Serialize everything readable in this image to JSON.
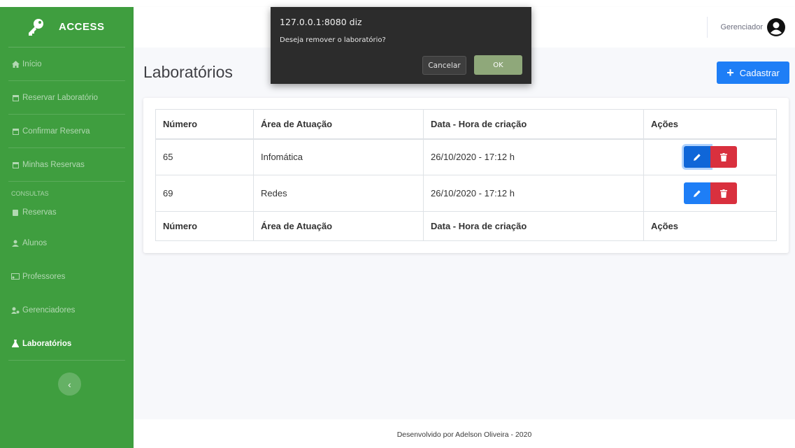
{
  "brand": {
    "name": "ACCESS"
  },
  "sidebar": {
    "items": [
      {
        "label": "Início",
        "icon": "home-icon"
      },
      {
        "label": "Reservar Laboratório",
        "icon": "calendar-icon"
      },
      {
        "label": "Confirmar Reserva",
        "icon": "calendar-check-icon"
      },
      {
        "label": "Minhas Reservas",
        "icon": "calendar-list-icon"
      }
    ],
    "section_heading": "CONSULTAS",
    "consultas": [
      {
        "label": "Reservas",
        "icon": "clipboard-icon"
      },
      {
        "label": "Alunos",
        "icon": "user-graduate-icon"
      },
      {
        "label": "Professores",
        "icon": "chalkboard-teacher-icon"
      },
      {
        "label": "Gerenciadores",
        "icon": "users-cog-icon"
      },
      {
        "label": "Laboratórios",
        "icon": "flask-icon",
        "active": true
      }
    ],
    "toggle_glyph": "‹"
  },
  "topbar": {
    "user_label": "Gerenciador"
  },
  "page": {
    "title": "Laboratórios",
    "add_button": "Cadastrar",
    "add_glyph": "+"
  },
  "table": {
    "headers": [
      "Número",
      "Área de Atuação",
      "Data - Hora de criação",
      "Ações"
    ],
    "rows": [
      {
        "numero": "65",
        "area": "Infomática",
        "data": "26/10/2020 - 17:12 h"
      },
      {
        "numero": "69",
        "area": "Redes",
        "data": "26/10/2020 - 17:12 h"
      }
    ]
  },
  "footer": {
    "text": "Desenvolvido por Adelson Oliveira - 2020"
  },
  "dialog": {
    "origin": "127.0.0.1:8080 diz",
    "message": "Deseja remover o laboratório?",
    "cancel": "Cancelar",
    "ok": "OK"
  },
  "colors": {
    "sidebar": "#3f9e3f",
    "primary": "#1e7ef6",
    "danger": "#d9303e",
    "dialog_ok": "#8fa87a"
  }
}
